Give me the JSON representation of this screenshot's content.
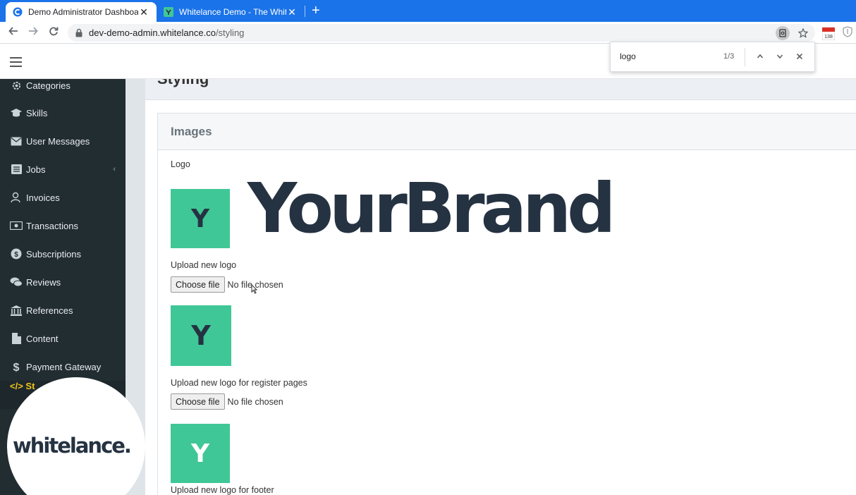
{
  "browser": {
    "tabs": [
      {
        "title": "Demo Administrator Dashboard",
        "active": true,
        "favicon": "c-logo-icon"
      },
      {
        "title": "Whitelance Demo - The White La",
        "active": false,
        "favicon": "whitelance-favicon"
      }
    ],
    "close_glyph": "✕",
    "newtab_glyph": "+",
    "url_host": "dev-demo-admin.whitelance.co",
    "url_path": "/styling",
    "extension_badge": "138"
  },
  "findbar": {
    "query": "logo",
    "count": "1/3"
  },
  "sidebar": {
    "items": [
      {
        "label": "Categories",
        "icon": "gear-icon"
      },
      {
        "label": "Skills",
        "icon": "graduation-cap-icon"
      },
      {
        "label": "User Messages",
        "icon": "envelope-icon"
      },
      {
        "label": "Jobs",
        "icon": "list-icon",
        "caret": "‹"
      },
      {
        "label": "Invoices",
        "icon": "user-dollar-icon"
      },
      {
        "label": "Transactions",
        "icon": "money-icon"
      },
      {
        "label": "Subscriptions",
        "icon": "coin-icon"
      },
      {
        "label": "Reviews",
        "icon": "comments-icon"
      },
      {
        "label": "References",
        "icon": "bank-icon"
      },
      {
        "label": "Content",
        "icon": "file-icon"
      },
      {
        "label": "Payment Gateway",
        "icon": "dollar-icon"
      }
    ],
    "active_peek": "</> St"
  },
  "page": {
    "title": "Styling",
    "card_title": "Images",
    "logo_label": "Logo",
    "brand_tile_letter": "Y",
    "brand_name": "YourBrand",
    "upload_logo_label": "Upload new logo",
    "upload_register_label": "Upload new logo for register pages",
    "upload_footer_label": "Upload new logo for footer",
    "choose_file_label": "Choose file",
    "no_file_label": "No file chosen"
  },
  "watermark": {
    "text": "whitelance."
  },
  "colors": {
    "brand_green": "#3fc797",
    "brand_navy": "#253242",
    "sidebar_bg": "#222d32",
    "chrome_blue": "#1a73e8"
  }
}
